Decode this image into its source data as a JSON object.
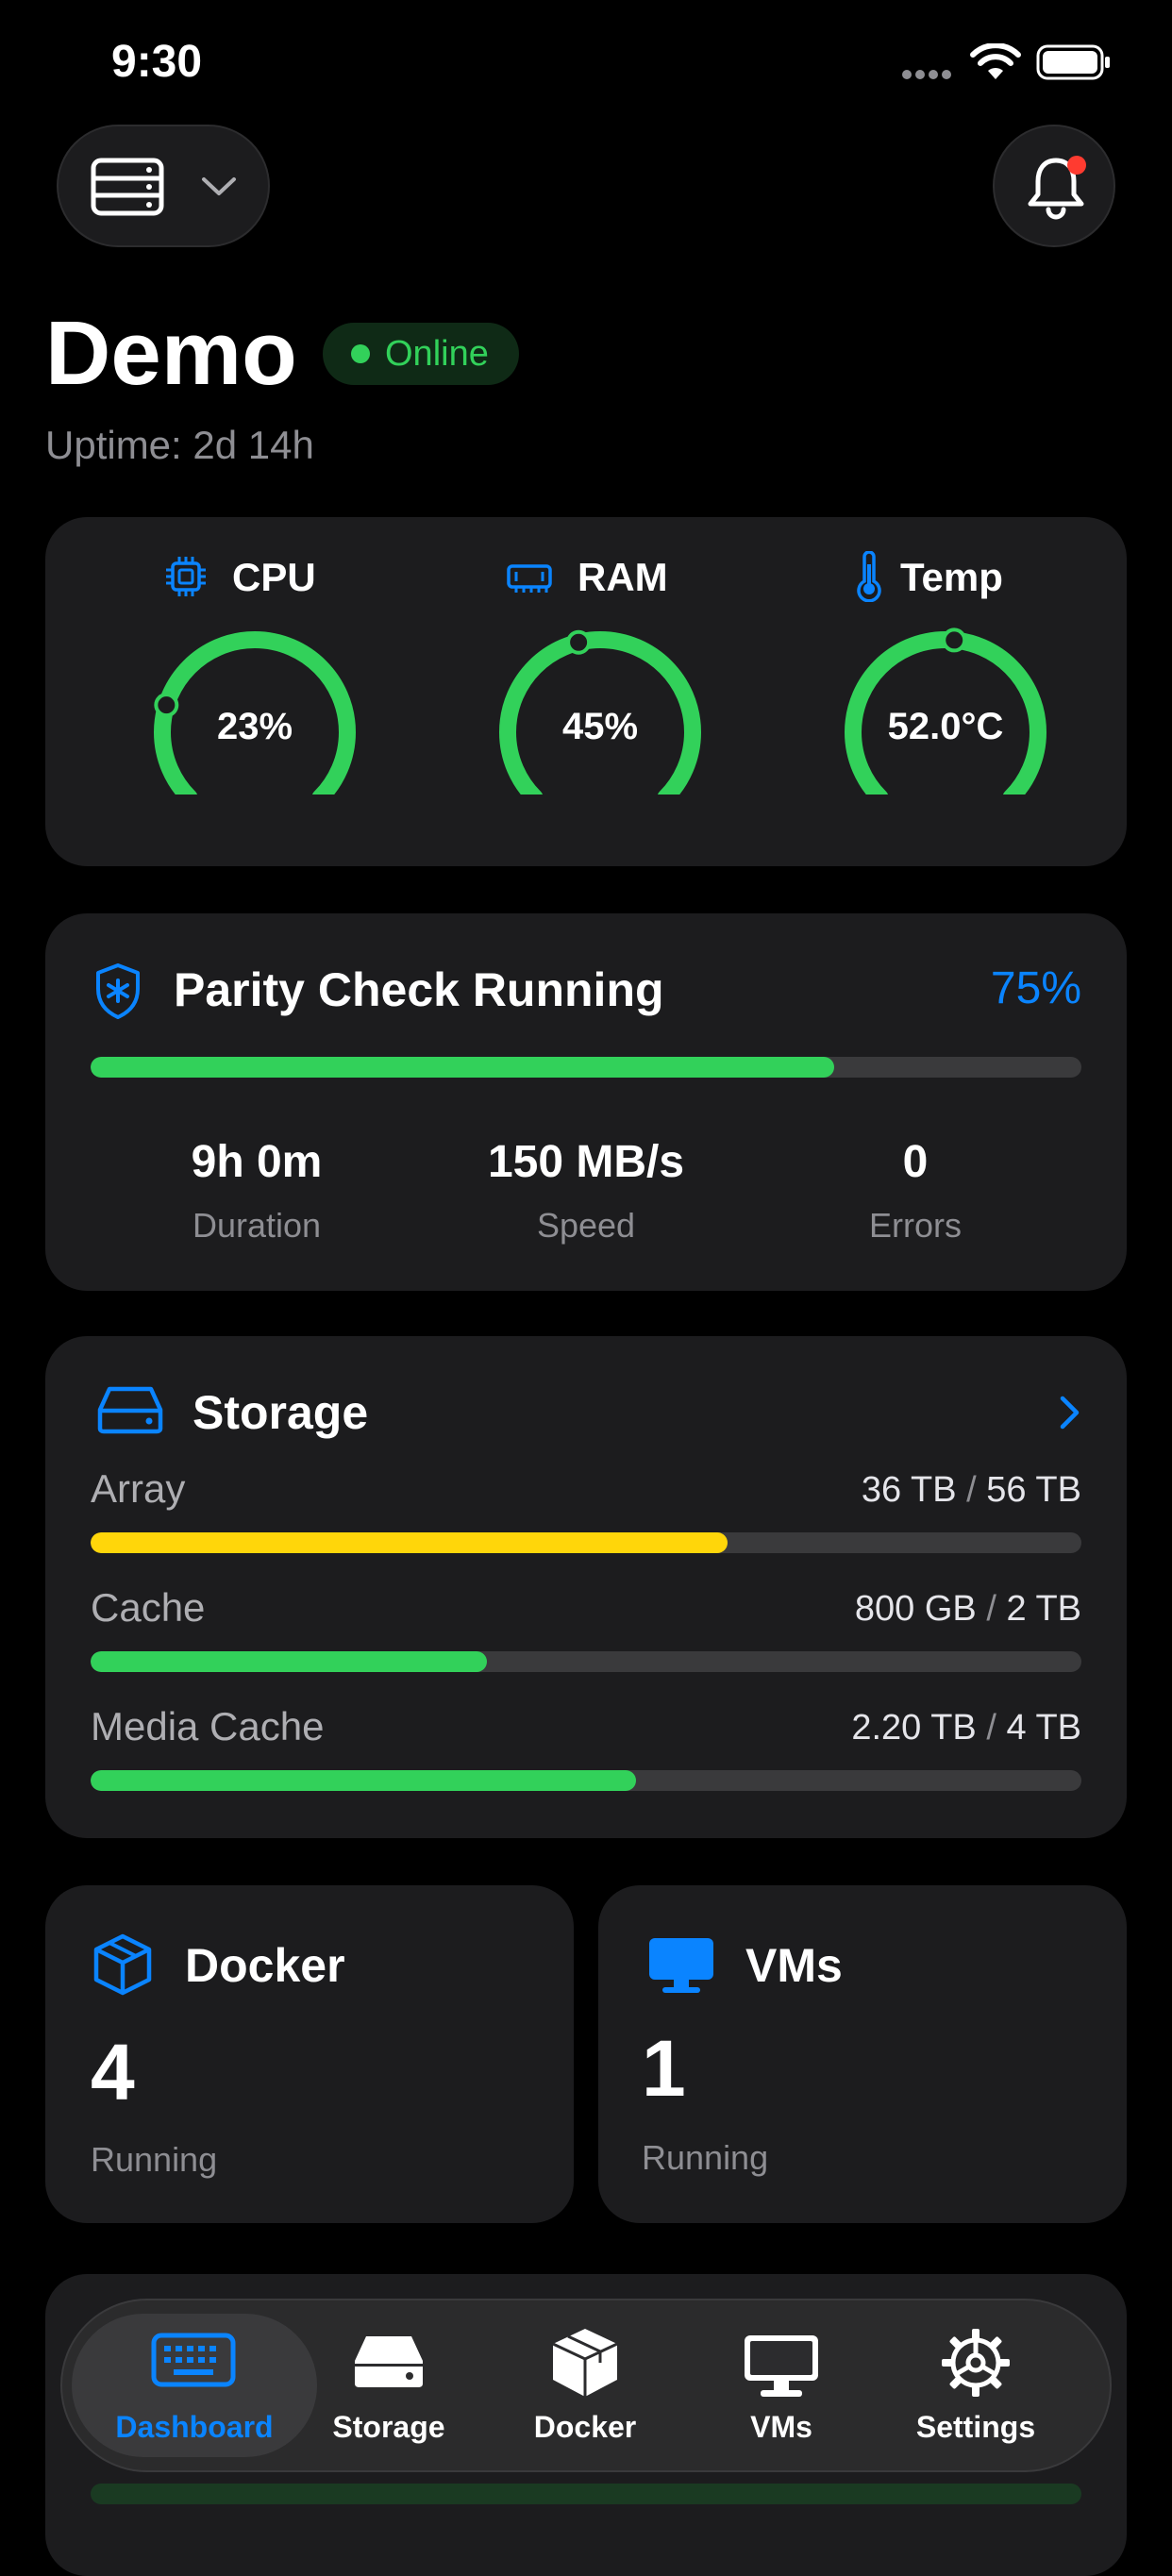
{
  "status_bar": {
    "time": "9:30"
  },
  "header": {
    "server_name": "Demo",
    "status": "Online",
    "uptime": "Uptime: 2d 14h"
  },
  "gauges": [
    {
      "label": "CPU",
      "value_text": "23%",
      "value": 0.23,
      "icon": "cpu-icon"
    },
    {
      "label": "RAM",
      "value_text": "45%",
      "value": 0.45,
      "icon": "memory-icon"
    },
    {
      "label": "Temp",
      "value_text": "52.0°C",
      "value": 0.52,
      "icon": "thermometer-icon"
    }
  ],
  "parity": {
    "title": "Parity Check Running",
    "percent_text": "75%",
    "progress": 0.75,
    "stats": [
      {
        "value": "9h 0m",
        "label": "Duration"
      },
      {
        "value": "150 MB/s",
        "label": "Speed"
      },
      {
        "value": "0",
        "label": "Errors"
      }
    ]
  },
  "storage": {
    "title": "Storage",
    "rows": [
      {
        "label": "Array",
        "used": "36 TB",
        "total": "56 TB",
        "fraction": 0.643,
        "color": "#ffd60a"
      },
      {
        "label": "Cache",
        "used": "800 GB",
        "total": "2 TB",
        "fraction": 0.4,
        "color": "#32d15a"
      },
      {
        "label": "Media Cache",
        "used": "2.20 TB",
        "total": "4 TB",
        "fraction": 0.55,
        "color": "#32d15a"
      }
    ]
  },
  "docker": {
    "title": "Docker",
    "count": "4",
    "status": "Running"
  },
  "vms": {
    "title": "VMs",
    "count": "1",
    "status": "Running"
  },
  "tabs": [
    {
      "label": "Dashboard",
      "icon": "keyboard-icon",
      "active": true
    },
    {
      "label": "Storage",
      "icon": "drive-icon",
      "active": false
    },
    {
      "label": "Docker",
      "icon": "box-icon",
      "active": false
    },
    {
      "label": "VMs",
      "icon": "monitor-icon",
      "active": false
    },
    {
      "label": "Settings",
      "icon": "gear-icon",
      "active": false
    }
  ],
  "colors": {
    "accent": "#0a84ff",
    "success": "#32d15a",
    "warning": "#ffd60a",
    "card": "#1c1c1e"
  }
}
